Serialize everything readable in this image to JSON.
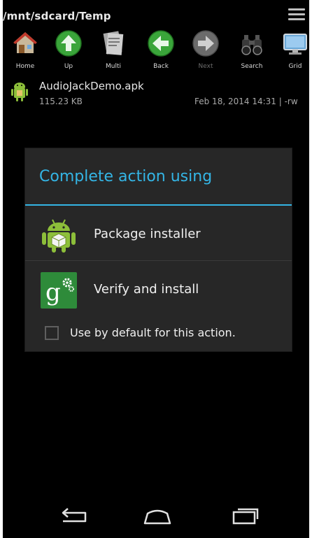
{
  "path_bar": {
    "path": "/mnt/sdcard/Temp",
    "menu_icon": "overflow-menu-icon"
  },
  "toolbar": {
    "items": [
      {
        "label": "Home",
        "icon": "house-icon",
        "enabled": true
      },
      {
        "label": "Up",
        "icon": "arrow-up-icon",
        "enabled": true
      },
      {
        "label": "Multi",
        "icon": "multi-files-icon",
        "enabled": true
      },
      {
        "label": "Back",
        "icon": "arrow-left-icon",
        "enabled": true
      },
      {
        "label": "Next",
        "icon": "arrow-right-icon",
        "enabled": false
      },
      {
        "label": "Search",
        "icon": "binoculars-icon",
        "enabled": true
      },
      {
        "label": "Grid",
        "icon": "grid-monitor-icon",
        "enabled": true
      }
    ]
  },
  "file": {
    "name": "AudioJackDemo.apk",
    "size": "115.23 KB",
    "date": "Feb 18, 2014 14:31 | -rw",
    "icon": "android-apk-icon"
  },
  "dialog": {
    "title": "Complete action using",
    "options": [
      {
        "label": "Package installer",
        "icon": "android-package-installer-icon"
      },
      {
        "label": "Verify and install",
        "icon": "google-settings-icon"
      }
    ],
    "default_checkbox": {
      "label": "Use by default for this action.",
      "checked": false
    }
  },
  "navbar": {
    "back": "back-icon",
    "home": "home-icon",
    "recents": "recents-icon"
  },
  "colors": {
    "accent": "#34b5e5",
    "dialog_bg": "#272727",
    "screen_bg": "#000000"
  }
}
